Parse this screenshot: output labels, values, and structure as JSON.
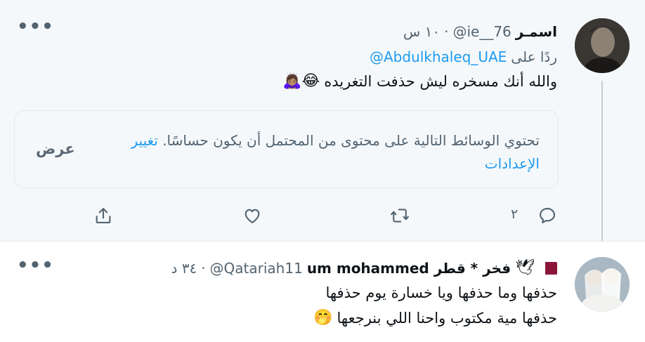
{
  "tweet1": {
    "author_name": "اسمـر",
    "handle": "@ie__76",
    "time": "١٠ س",
    "separator": "·",
    "reply_prefix": "ردًا على",
    "reply_to": "@Abdulkhaleq_UAE",
    "text": "والله أنك مسخره ليش حذفت التغريده",
    "emojis": "🙇🏽‍♀️😂",
    "media_warning": {
      "text": "تحتوي الوسائط التالية على محتوى من المحتمل أن يكون حساسًا.",
      "settings_link": "تغيير الإعدادات",
      "show_label": "عرض"
    },
    "actions": {
      "reply_icon": "reply-icon",
      "reply_count": "٢",
      "retweet_icon": "retweet-icon",
      "like_icon": "heart-icon",
      "share_icon": "share-icon"
    },
    "more_label": "•••"
  },
  "tweet2": {
    "author_name": "فخر * قطر um mohammed",
    "handle": "@Qatariah11",
    "time": "٣٤ د",
    "separator": "·",
    "line1": "حذفها وما حذفها ويا خسارة يوم حذفها",
    "line2": "حذفها مية مكتوب واحنا اللي بنرجعها",
    "emoji_line2": "🤭",
    "name_emojis": "🕊",
    "more_label": "•••"
  },
  "colors": {
    "accent": "#1d9bf0",
    "secondary_text": "#536471",
    "highlight_bg": "#f5f8fa",
    "qatar_maroon": "#8a1538"
  }
}
